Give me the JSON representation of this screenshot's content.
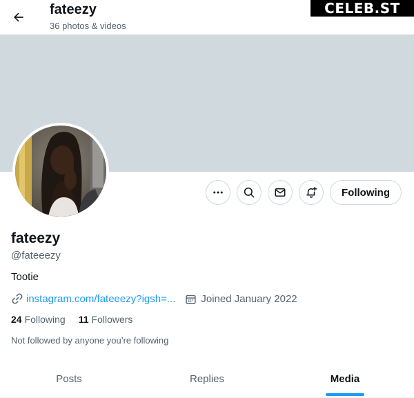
{
  "header": {
    "title": "fateezy",
    "subtitle": "36 photos & videos",
    "back_icon": "arrow-left-icon"
  },
  "watermark": "CELEB.ST",
  "colors": {
    "banner": "#cfd9de",
    "link": "#1d9bf0",
    "secondary_text": "#536471",
    "primary_text": "#0f1419"
  },
  "actions": {
    "more_icon": "more-horizontal-icon",
    "search_icon": "search-icon",
    "message_icon": "envelope-icon",
    "notify_icon": "bell-plus-icon",
    "follow_label": "Following"
  },
  "profile": {
    "display_name": "fateezy",
    "handle": "@fateeezy",
    "bio": "Tootie",
    "link": "instagram.com/fateeezy?igsh=...",
    "joined": "Joined January 2022",
    "following_count": "24",
    "following_label": "Following",
    "followers_count": "11",
    "followers_label": "Followers",
    "not_followed_text": "Not followed by anyone you’re following"
  },
  "tabs": [
    {
      "label": "Posts",
      "active": false
    },
    {
      "label": "Replies",
      "active": false
    },
    {
      "label": "Media",
      "active": true
    }
  ]
}
